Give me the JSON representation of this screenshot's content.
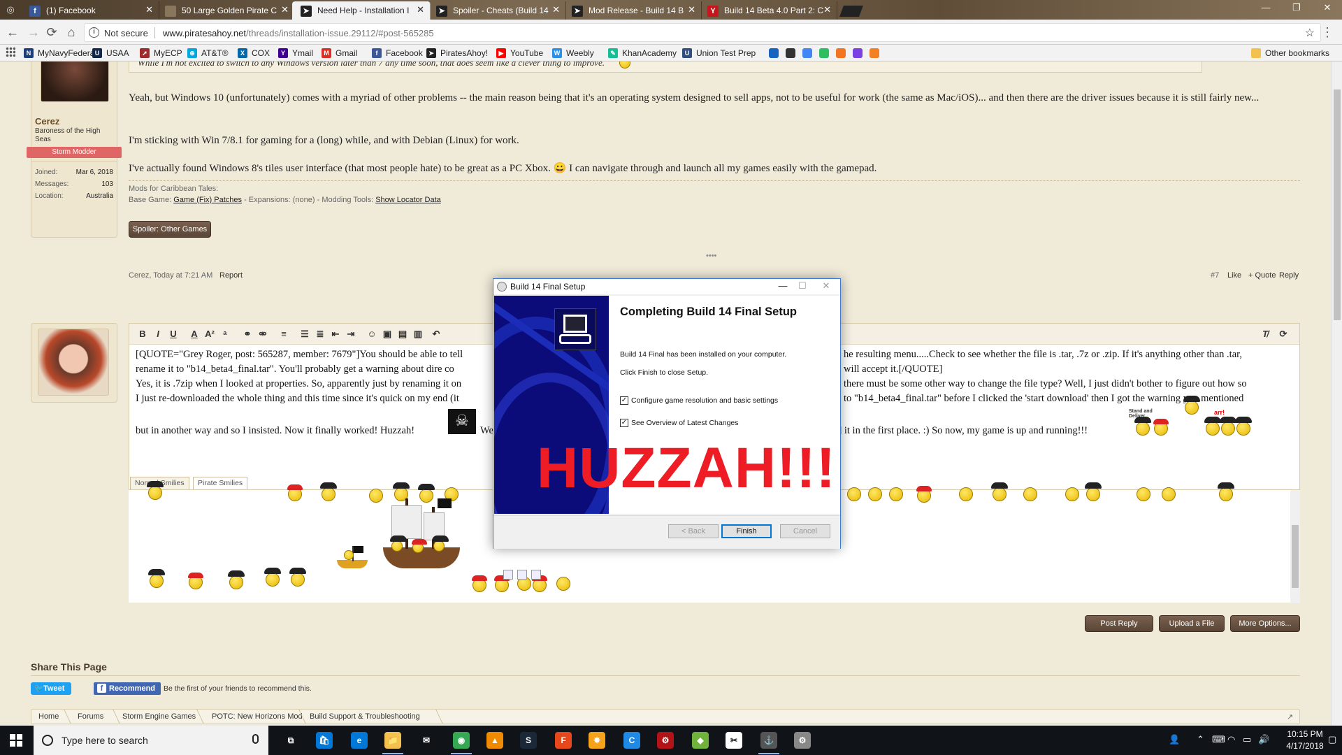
{
  "browser": {
    "tabs": [
      {
        "title": "(1) Facebook",
        "icon": "facebook-icon",
        "color": "#3b5998",
        "glyph": "f"
      },
      {
        "title": "50 Large Golden Pirate C",
        "icon": "page-icon",
        "color": "#8a765c",
        "glyph": ""
      },
      {
        "title": "Need Help - Installation I",
        "icon": "piratesahoy-icon",
        "color": "#222222",
        "glyph": "➤"
      },
      {
        "title": "Spoiler - Cheats (Build 14",
        "icon": "piratesahoy-icon",
        "color": "#222222",
        "glyph": "➤"
      },
      {
        "title": "Mod Release - Build 14 B",
        "icon": "piratesahoy-icon",
        "color": "#222222",
        "glyph": "➤"
      },
      {
        "title": "Build 14 Beta 4.0 Part 2: C",
        "icon": "yahoo-icon",
        "color": "#c4161c",
        "glyph": "Y"
      }
    ],
    "address": {
      "security": "Not secure",
      "url_host": "www.piratesahoy.net",
      "url_path": "/threads/installation-issue.29112/#post-565285"
    },
    "bookmarks": [
      {
        "label": "MyNavyFederal",
        "icon": "navy-federal-icon",
        "color": "#1c3e7a",
        "glyph": "N"
      },
      {
        "label": "USAA",
        "icon": "usaa-icon",
        "color": "#12274c",
        "glyph": "U"
      },
      {
        "label": "MyECP",
        "icon": "ecp-icon",
        "color": "#9e2a2b",
        "glyph": "➚"
      },
      {
        "label": "AT&T®",
        "icon": "att-icon",
        "color": "#00a8e0",
        "glyph": "⊕"
      },
      {
        "label": "COX",
        "icon": "cox-icon",
        "color": "#0069aa",
        "glyph": "X"
      },
      {
        "label": "Ymail",
        "icon": "yahoo-icon",
        "color": "#410093",
        "glyph": "Y"
      },
      {
        "label": "Gmail",
        "icon": "gmail-icon",
        "color": "#d93025",
        "glyph": "M"
      },
      {
        "label": "Facebook",
        "icon": "facebook-icon",
        "color": "#3b5998",
        "glyph": "f"
      },
      {
        "label": "PiratesAhoy!",
        "icon": "piratesahoy-icon",
        "color": "#222222",
        "glyph": "➤"
      },
      {
        "label": "YouTube",
        "icon": "youtube-icon",
        "color": "#ff0000",
        "glyph": "▶"
      },
      {
        "label": "Weebly",
        "icon": "weebly-icon",
        "color": "#2990ea",
        "glyph": "W"
      },
      {
        "label": "KhanAcademy",
        "icon": "khan-academy-icon",
        "color": "#14bf96",
        "glyph": "✎"
      },
      {
        "label": "Union Test Prep",
        "icon": "union-test-prep-icon",
        "color": "#2f4f7f",
        "glyph": "U"
      }
    ],
    "bookmark_icons_only": [
      {
        "icon": "circle-icon",
        "color": "#1565c0"
      },
      {
        "icon": "arrow-icon",
        "color": "#333333"
      },
      {
        "icon": "translate-icon",
        "color": "#4285f4"
      },
      {
        "icon": "evernote-icon",
        "color": "#2dbe60"
      },
      {
        "icon": "crunchyroll-icon",
        "color": "#f47521"
      },
      {
        "icon": "purple-play-icon",
        "color": "#7b3fe4"
      },
      {
        "icon": "orange-c-icon",
        "color": "#f48024"
      }
    ],
    "other_bookmarks": "Other bookmarks"
  },
  "post1": {
    "quote_text": "While I'm not excited to switch to any Windows version later than 7 any time soon, that does seem like a clever thing to improve.",
    "username": "Cerez",
    "user_title": "Baroness of the High Seas",
    "user_badge": "Storm Modder",
    "stats": [
      {
        "label": "Joined:",
        "value": "Mar 6, 2018"
      },
      {
        "label": "Messages:",
        "value": "103"
      },
      {
        "label": "Location:",
        "value": "Australia"
      }
    ],
    "paragraphs": [
      "Yeah, but Windows 10 (unfortunately) comes with a myriad of other problems -- the main reason being that it's an operating system designed to sell apps, not to be useful for work (the same as Mac/iOS)... and then there are the driver issues because it is still fairly new...",
      "I'm sticking with Win 7/8.1 for gaming for a (long) while, and with Debian (Linux) for work.",
      "I've actually found Windows 8's tiles user interface (that most people hate) to be great as a PC Xbox. 😀 I can navigate through and launch all my games easily with the gamepad."
    ],
    "sig_title": "Mods for Caribbean Tales:",
    "sig_base": "Base Game:",
    "sig_base_link": "Game (Fix) Patches",
    "sig_mid": " - Expansions: (none) - Modding Tools: ",
    "sig_tools_link": "Show Locator Data",
    "spoiler_button": "Spoiler: Other Games",
    "more_dots": "••••",
    "meta_author": "Cerez, Today at 7:21 AM",
    "report": "Report",
    "post_number": "#7",
    "like": "Like",
    "quote": "+ Quote",
    "reply": "Reply"
  },
  "editor": {
    "lines": [
      "[QUOTE=\"Grey Roger, post: 565287, member: 7679\"]You should be able to tell",
      "rename it to \"b14_beta4_final.tar\". You'll probably get a warning about dire co",
      "Yes, it is .7zip when I looked at properties. So, apparently just by renaming it on",
      "I just re-downloaded the whole thing and this time since it's quick on my end (it",
      "but in another way and so I insisted. Now it finally worked! Huzzah!",
      "We"
    ],
    "lines_right": [
      "he resulting menu.....Check to see whether the file is .tar, .7z or .zip. If it's anything other than .tar,",
      "will accept it.[/QUOTE]",
      "there must be some other way to change the file type? Well, I just didn't bother to figure out how so",
      "to \"b14_beta4_final.tar\" before I clicked the 'start download' then I got the warning you mentioned",
      "d it in the first place. :) So now, my game is up and running!!!"
    ],
    "smilie_tabs": [
      "Normal Smilies",
      "Pirate Smilies"
    ],
    "sign_label": "Stand and Deliver",
    "arr_label": "arr!"
  },
  "actions": {
    "post_reply": "Post Reply",
    "upload_file": "Upload a File",
    "more_options": "More Options..."
  },
  "share": {
    "heading": "Share This Page",
    "tweet": "Tweet",
    "recommend": "Recommend",
    "recommend_note": "Be the first of your friends to recommend this."
  },
  "breadcrumbs": [
    "Home",
    "Forums",
    "Storm Engine Games",
    "POTC: New Horizons Mod",
    "Build Support & Troubleshooting"
  ],
  "dialog": {
    "title": "Build 14 Final Setup",
    "heading": "Completing Build 14 Final Setup",
    "line1": "Build 14 Final has been installed on your computer.",
    "line2": "Click Finish to close Setup.",
    "check1": "Configure game resolution and basic settings",
    "check2": "See Overview of Latest Changes",
    "overlay": "HUZZAH!!!",
    "back": "< Back",
    "finish": "Finish",
    "cancel": "Cancel"
  },
  "taskbar": {
    "search_placeholder": "Type here to search",
    "apps": [
      {
        "icon": "task-view-icon",
        "color": "#101317",
        "glyph": "⧉"
      },
      {
        "icon": "store-icon",
        "color": "#0078d7",
        "glyph": "🛍"
      },
      {
        "icon": "edge-icon",
        "color": "#0078d7",
        "glyph": "e"
      },
      {
        "icon": "file-explorer-icon",
        "color": "#f2c14e",
        "glyph": "📁"
      },
      {
        "icon": "mail-icon",
        "color": "#101317",
        "glyph": "✉"
      },
      {
        "icon": "chrome-icon",
        "color": "#34a853",
        "glyph": "◉"
      },
      {
        "icon": "vlc-icon",
        "color": "#f08a00",
        "glyph": "▲"
      },
      {
        "icon": "steam-icon",
        "color": "#1b2838",
        "glyph": "S"
      },
      {
        "icon": "f-app-icon",
        "color": "#e8461b",
        "glyph": "F"
      },
      {
        "icon": "sparkle-app-icon",
        "color": "#f6a21a",
        "glyph": "✸"
      },
      {
        "icon": "refresh-app-icon",
        "color": "#1e8ae6",
        "glyph": "C"
      },
      {
        "icon": "red-app-icon",
        "color": "#b31217",
        "glyph": "⚙"
      },
      {
        "icon": "layers-app-icon",
        "color": "#6fb33d",
        "glyph": "◆"
      },
      {
        "icon": "snip-icon",
        "color": "#ffffff",
        "glyph": "✂"
      },
      {
        "icon": "installer-icon",
        "color": "#555555",
        "glyph": "⚓"
      },
      {
        "icon": "settings-app-icon",
        "color": "#888888",
        "glyph": "⚙"
      }
    ],
    "time": "10:15 PM",
    "date": "4/17/2018"
  }
}
